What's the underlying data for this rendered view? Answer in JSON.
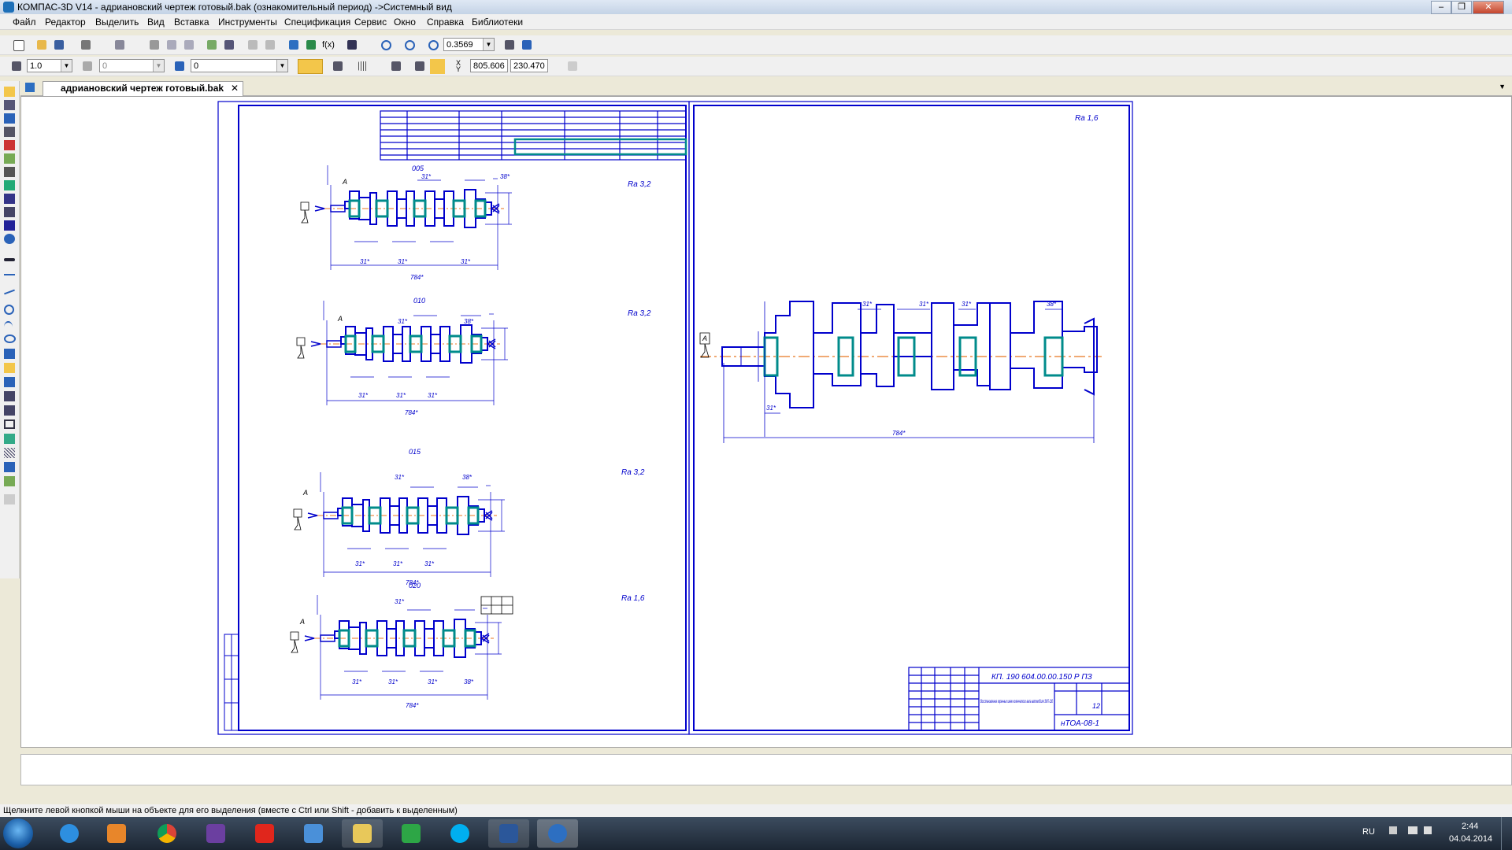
{
  "window": {
    "title": "КОМПАС-3D V14 - адриановский чертеж готовый.bak (ознакомительный период) ->Системный вид"
  },
  "menu": [
    "Файл",
    "Редактор",
    "Выделить",
    "Вид",
    "Вставка",
    "Инструменты",
    "Спецификация",
    "Сервис",
    "Окно",
    "Справка",
    "Библиотеки"
  ],
  "toolbar1": {
    "zoom_value": "0.3569"
  },
  "toolbar2": {
    "line_scale": "1.0",
    "style_value": "0",
    "layer_value": "0",
    "coord_x_label": "X",
    "coord_y_label": "Y",
    "coord_x": "805.606",
    "coord_y": "230.470"
  },
  "document_tab": {
    "label": "адриановский чертеж готовый.bak",
    "close": "✕"
  },
  "drawing": {
    "ops": [
      "005",
      "010",
      "015",
      "020"
    ],
    "roughness": [
      "Rа 3,2",
      "Rа 3,2",
      "Rа 3,2",
      "Rа 1,6",
      "Rа 1,6"
    ],
    "dim_31": "31*",
    "dim_38": "38*",
    "dim_length": "784*",
    "base_label": "А",
    "title_block": {
      "doc_code": "КП. 190 604.00.00.150 Р ПЗ",
      "name": "Восстановление коренных шеек коленчатого вала автомобиля ЗИЛ-130",
      "sheet": "12",
      "org": "нТОА-08-1"
    }
  },
  "status": {
    "hint": "Щелкните левой кнопкой мыши на объекте для его выделения (вместе с Ctrl или Shift - добавить к выделенным)"
  },
  "taskbar": {
    "lang": "RU",
    "time": "2:44",
    "date": "04.04.2014"
  },
  "colors": {
    "drawing_line": "#0000cc",
    "journal": "#008b8b",
    "axis": "#e87722"
  }
}
